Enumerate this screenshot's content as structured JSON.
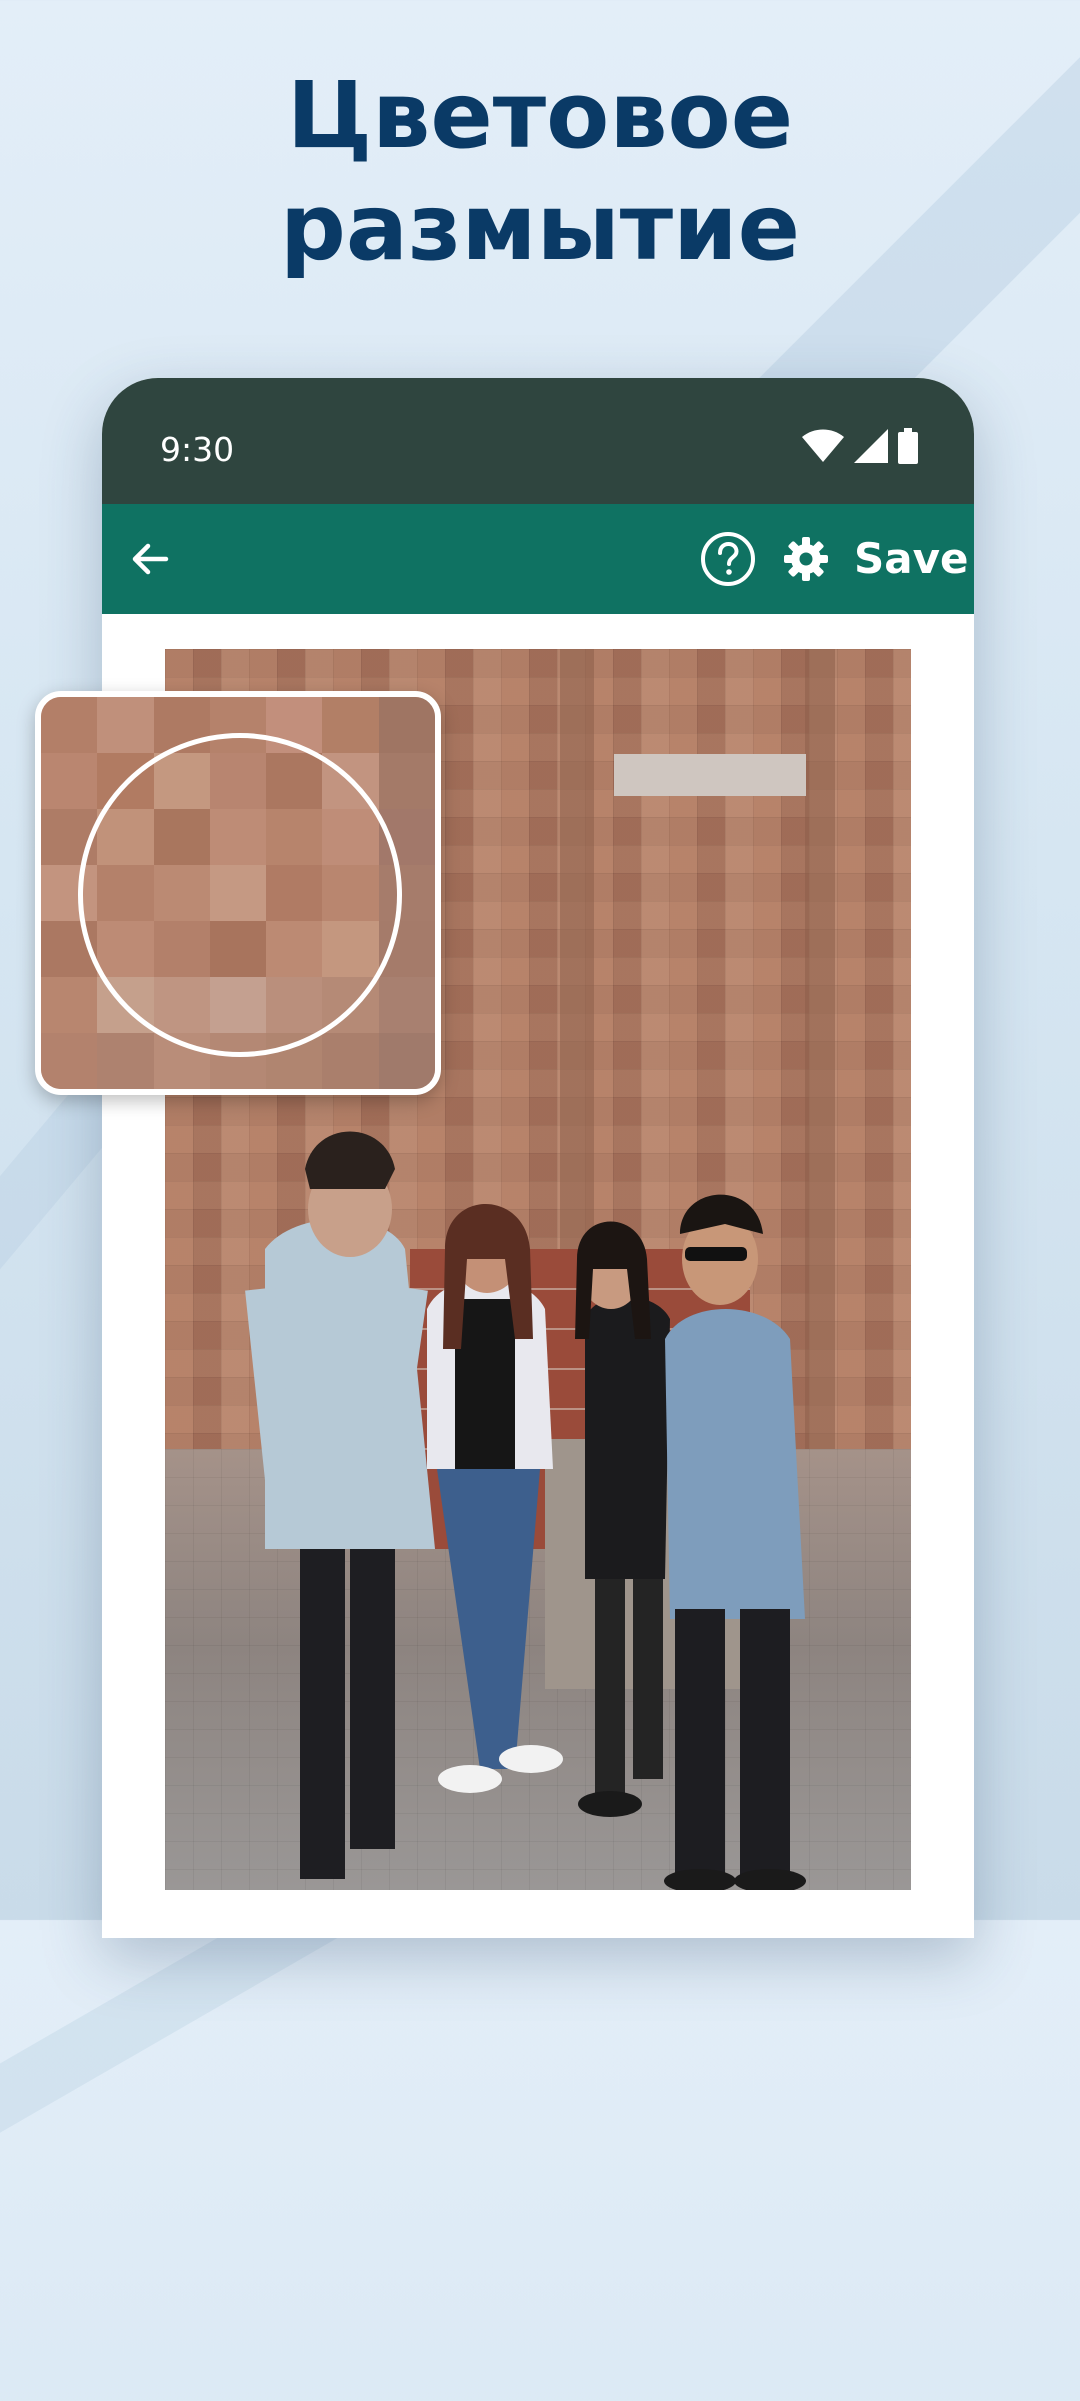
{
  "headline": {
    "line1": "Цветовое",
    "line2": "размытие"
  },
  "status_bar": {
    "time": "9:30",
    "icons": [
      "wifi-icon",
      "signal-icon",
      "battery-icon"
    ]
  },
  "app_bar": {
    "back_icon": "arrow-left-icon",
    "help_icon": "help-circle-icon",
    "settings_icon": "gear-icon",
    "save_label": "Save"
  },
  "colors": {
    "status_bar": "#2f453f",
    "app_bar": "#0f7262",
    "headline": "#0a3a66",
    "photo_brick": "#a5765f"
  },
  "magnifier": {
    "colors": [
      "#b37f68",
      "#c0907b",
      "#ae7a63",
      "#b5826b",
      "#c28f7c",
      "#b27f66",
      "#9f7563",
      "#ba8670",
      "#b17b62",
      "#c49880",
      "#b88570",
      "#ab7760",
      "#c29480",
      "#a47a68",
      "#ae7c66",
      "#c1927a",
      "#a9765e",
      "#be8c76",
      "#b7846c",
      "#bf8d78",
      "#a2786a",
      "#c3947f",
      "#b4816a",
      "#bb8a73",
      "#c59983",
      "#b07b64",
      "#b9866f",
      "#a67c6b",
      "#ab7862",
      "#bd8b75",
      "#b3806a",
      "#a8745d",
      "#bc8a73",
      "#c4977f",
      "#a57b6a",
      "#b8866f",
      "#c5a08c",
      "#bf9582",
      "#c4a090",
      "#ba8f7c",
      "#b58a76",
      "#a88070",
      "#b3826d",
      "#ae826f",
      "#b98d79",
      "#b48874",
      "#b08570",
      "#aa7f6c",
      "#a07a6b"
    ]
  }
}
